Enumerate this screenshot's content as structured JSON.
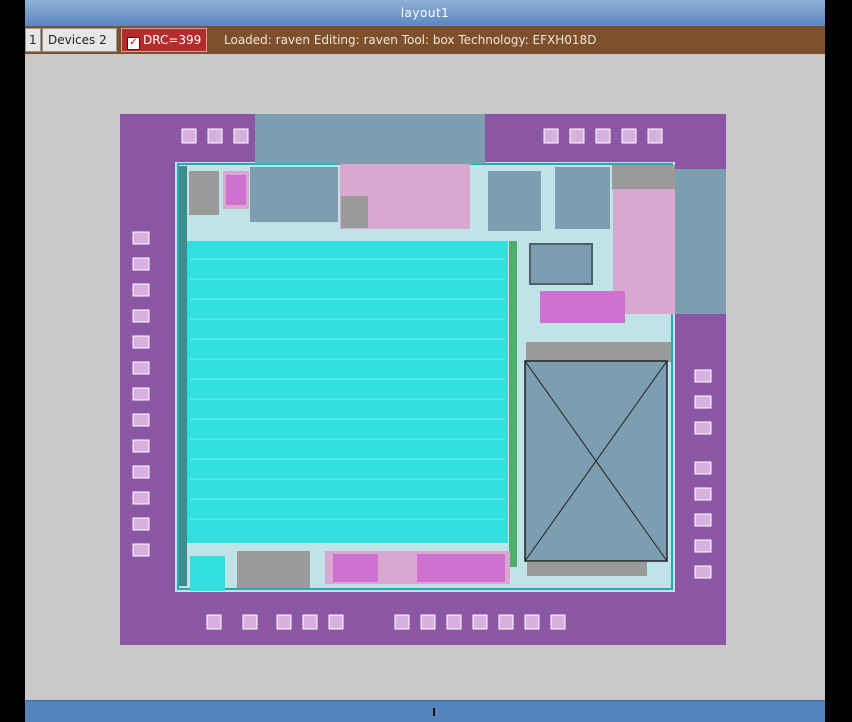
{
  "window": {
    "title": "layout1"
  },
  "toolbar": {
    "tab_one_label": "1",
    "devices_label": "Devices 2",
    "drc_label": "DRC=399",
    "drc_checked": true,
    "status_text": "Loaded: raven Editing: raven Tool: box  Technology: EFXH018D"
  },
  "colors": {
    "titlebar": "#6f97c9",
    "toolbar": "#7d4f2a",
    "drc_badge": "#b32d2d",
    "canvas_bg": "#c9c9c9",
    "pad_ring": "#8b57a5",
    "logic_block": "#33dede",
    "analog_block": "#7d9db0",
    "pink_layer": "#d28bd0",
    "bottom_bar": "#5483bd"
  },
  "layout_view": {
    "design": "raven",
    "technology": "EFXH018D"
  }
}
